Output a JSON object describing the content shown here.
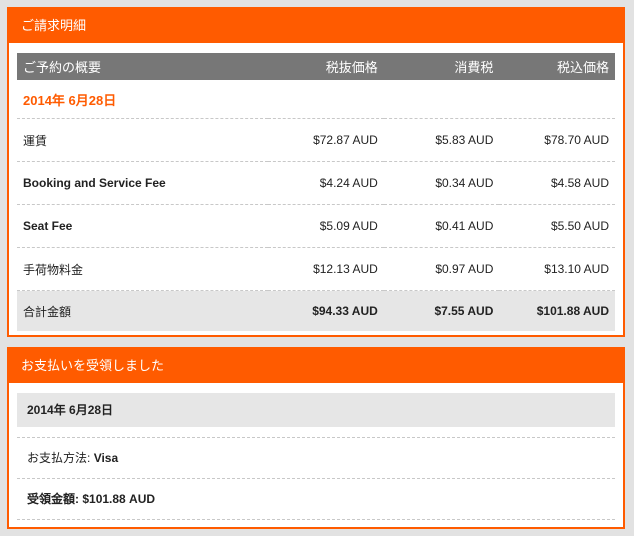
{
  "invoice": {
    "title": "ご請求明細",
    "headers": [
      "ご予約の概要",
      "税抜価格",
      "消費税",
      "税込価格"
    ],
    "date": "2014年 6月28日",
    "rows": [
      {
        "label": "運賃",
        "pretax": "$72.87 AUD",
        "tax": "$5.83 AUD",
        "total": "$78.70 AUD"
      },
      {
        "label": "Booking and Service Fee",
        "pretax": "$4.24 AUD",
        "tax": "$0.34 AUD",
        "total": "$4.58 AUD"
      },
      {
        "label": "Seat Fee",
        "pretax": "$5.09 AUD",
        "tax": "$0.41 AUD",
        "total": "$5.50 AUD"
      },
      {
        "label": "手荷物料金",
        "pretax": "$12.13 AUD",
        "tax": "$0.97 AUD",
        "total": "$13.10 AUD"
      }
    ],
    "total_row": {
      "label": "合計金額",
      "pretax": "$94.33 AUD",
      "tax": "$7.55 AUD",
      "total": "$101.88 AUD"
    }
  },
  "payment": {
    "title": "お支払いを受領しました",
    "date": "2014年 6月28日",
    "method_label": "お支払方法:",
    "method_value": "Visa",
    "amount_label": "受領金額:",
    "amount_value": "$101.88 AUD"
  },
  "colors": {
    "accent": "#ff5b00",
    "header_gray": "#777777",
    "row_gray": "#e6e6e6"
  }
}
